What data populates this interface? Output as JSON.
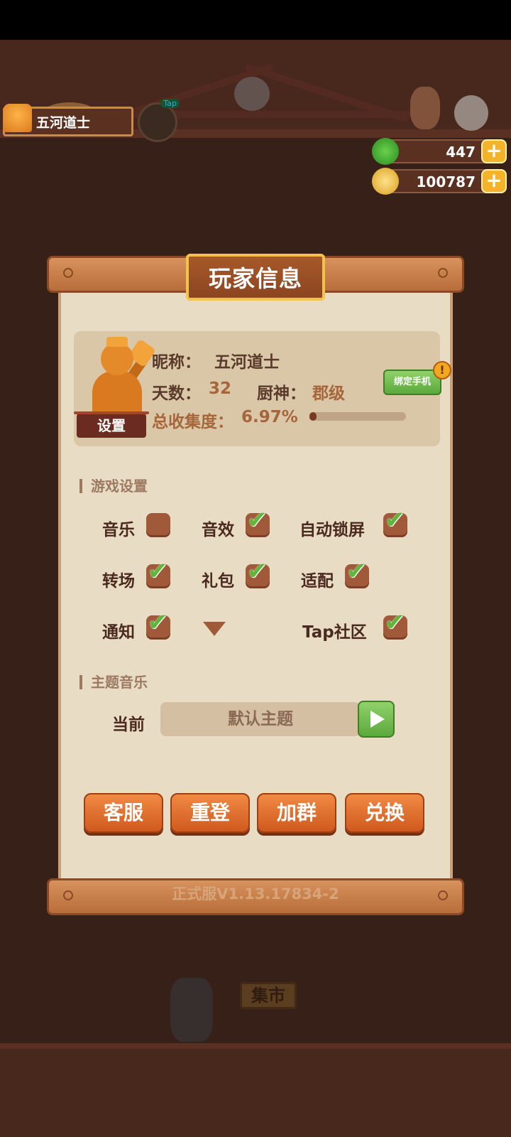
{
  "player_tag": {
    "name": "五河道士",
    "tap_badge": "Tap"
  },
  "currencies": [
    {
      "icon": "jade-icon",
      "value": "447",
      "color": "#3aa035"
    },
    {
      "icon": "coin-icon",
      "value": "100787",
      "color": "#f3b42a"
    }
  ],
  "dialog": {
    "title": "玩家信息",
    "nickname_label": "昵称：",
    "nickname": "五河道士",
    "days_label": "天数：",
    "days": "32",
    "chef_label": "厨神：",
    "chef_rank": "郡级",
    "collection_label": "总收集度：",
    "collection_value": "6.97%",
    "collection_progress": 0.07,
    "settings_button": "设置",
    "bind_phone_button": "绑定手机",
    "alert_badge": "!",
    "game_settings_header": "游戏设置",
    "options": [
      {
        "label": "音乐",
        "checked": false
      },
      {
        "label": "音效",
        "checked": true
      },
      {
        "label": "自动锁屏",
        "checked": true
      },
      {
        "label": "转场",
        "checked": true
      },
      {
        "label": "礼包",
        "checked": true
      },
      {
        "label": "适配",
        "checked": true
      },
      {
        "label": "通知",
        "checked": true
      },
      {
        "label": "Tap社区",
        "checked": true
      }
    ],
    "theme_music_header": "主题音乐",
    "current_label": "当前",
    "current_theme": "默认主题",
    "buttons": [
      "客服",
      "重登",
      "加群",
      "兑换"
    ],
    "version": "正式服V1.13.17834-2"
  },
  "background": {
    "market_sign": "集市"
  }
}
